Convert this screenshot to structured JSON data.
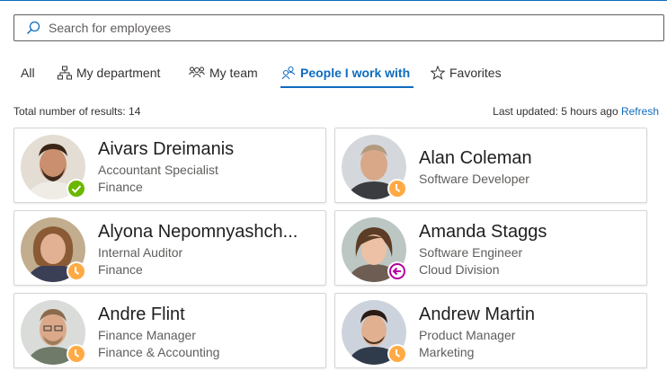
{
  "search": {
    "placeholder": "Search for employees",
    "value": ""
  },
  "tabs": [
    {
      "label": "All",
      "icon": "none",
      "active": false
    },
    {
      "label": "My department",
      "icon": "org-chart-icon",
      "active": false
    },
    {
      "label": "My team",
      "icon": "people-team-icon",
      "active": false
    },
    {
      "label": "People I work with",
      "icon": "people-connection-icon",
      "active": true
    },
    {
      "label": "Favorites",
      "icon": "star-icon",
      "active": false
    }
  ],
  "summary": {
    "total_label": "Total number of results: 14"
  },
  "updated": {
    "text": "Last updated: 5 hours ago",
    "refresh_label": "Refresh"
  },
  "colors": {
    "accent": "#0f6cbd",
    "available": "#6bb700",
    "away": "#ffaa44",
    "out_of_office": "#b4009e"
  },
  "people": [
    {
      "name": "Aivars Dreimanis",
      "title": "Accountant Specialist",
      "department": "Finance",
      "presence": "available"
    },
    {
      "name": "Alan Coleman",
      "title": "Software Developer",
      "department": "",
      "presence": "away"
    },
    {
      "name": "Alyona Nepomnyashch...",
      "title": "Internal Auditor",
      "department": "Finance",
      "presence": "away"
    },
    {
      "name": "Amanda Staggs",
      "title": "Software Engineer",
      "department": "Cloud Division",
      "presence": "out-of-office"
    },
    {
      "name": "Andre Flint",
      "title": "Finance Manager",
      "department": "Finance & Accounting",
      "presence": "away"
    },
    {
      "name": "Andrew Martin",
      "title": "Product Manager",
      "department": "Marketing",
      "presence": "away"
    }
  ]
}
